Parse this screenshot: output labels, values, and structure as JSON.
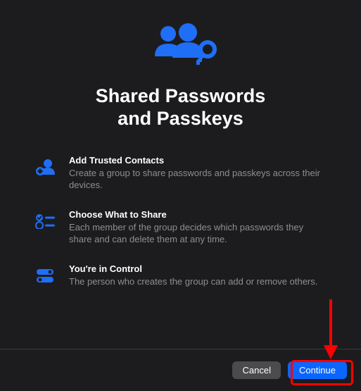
{
  "title_line1": "Shared Passwords",
  "title_line2": "and Passkeys",
  "features": [
    {
      "title": "Add Trusted Contacts",
      "desc": "Create a group to share passwords and passkeys across their devices."
    },
    {
      "title": "Choose What to Share",
      "desc": "Each member of the group decides which passwords they share and can delete them at any time."
    },
    {
      "title": "You're in Control",
      "desc": "The person who creates the group can add or remove others."
    }
  ],
  "buttons": {
    "cancel": "Cancel",
    "continue": "Continue"
  },
  "colors": {
    "accent": "#1f6ef6",
    "highlight": "#ff0000"
  }
}
